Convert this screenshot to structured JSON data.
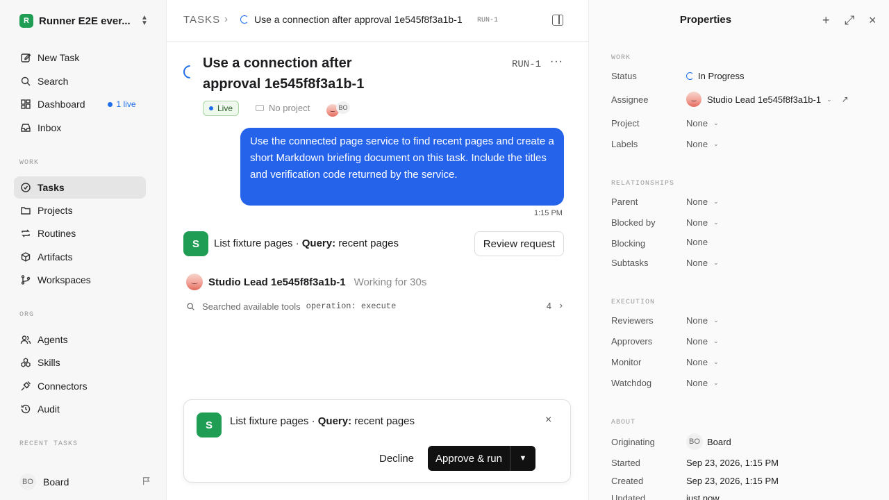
{
  "workspace": {
    "logo_letter": "R",
    "name": "Runner E2E ever..."
  },
  "sidebar": {
    "primary": [
      {
        "label": "New Task",
        "icon": "edit-icon"
      },
      {
        "label": "Search",
        "icon": "search-icon"
      },
      {
        "label": "Dashboard",
        "icon": "dashboard-icon",
        "live_count": "1 live"
      },
      {
        "label": "Inbox",
        "icon": "inbox-icon"
      }
    ],
    "work_label": "WORK",
    "work": [
      {
        "label": "Tasks",
        "icon": "check-circle-icon",
        "active": true
      },
      {
        "label": "Projects",
        "icon": "folder-icon"
      },
      {
        "label": "Routines",
        "icon": "repeat-icon"
      },
      {
        "label": "Artifacts",
        "icon": "box-icon"
      },
      {
        "label": "Workspaces",
        "icon": "branch-icon"
      }
    ],
    "org_label": "ORG",
    "org": [
      {
        "label": "Agents",
        "icon": "users-icon"
      },
      {
        "label": "Skills",
        "icon": "skills-icon"
      },
      {
        "label": "Connectors",
        "icon": "plug-icon"
      },
      {
        "label": "Audit",
        "icon": "history-icon"
      }
    ],
    "recent_label": "RECENT TASKS",
    "user": {
      "initials": "BO",
      "name": "Board"
    }
  },
  "header": {
    "crumb_root": "TASKS",
    "crumb_sep": "›",
    "task_title": "Use a connection after approval 1e545f8f3a1b-1",
    "task_id": "RUN-1"
  },
  "task": {
    "title": "Use a connection after approval 1e545f8f3a1b-1",
    "id": "RUN-1",
    "more": "···",
    "status_badge": "Live",
    "project": "No project",
    "assignee_initials": "BO"
  },
  "message": {
    "text": "Use the connected page service to find recent pages and create a short Markdown briefing document on this task. Include the titles and verification code returned by the service.",
    "time": "1:15 PM"
  },
  "request": {
    "badge": "S",
    "name": "List fixture pages",
    "sep": " · ",
    "query_label": "Query:",
    "query_value": " recent pages",
    "review_label": "Review request"
  },
  "agent": {
    "name": "Studio Lead 1e545f8f3a1b-1",
    "status": "Working for 30s"
  },
  "tool": {
    "text": "Searched available tools",
    "op": "operation: execute",
    "count": "4",
    "chevron": "›"
  },
  "approval": {
    "badge": "S",
    "name": "List fixture pages",
    "sep": " · ",
    "query_label": "Query:",
    "query_value": " recent pages",
    "close": "×",
    "decline": "Decline",
    "approve": "Approve & run",
    "dropdown": "▼"
  },
  "properties": {
    "title": "Properties",
    "add_icon": "+",
    "expand_icon": "⤢",
    "close_icon": "×",
    "work_label": "WORK",
    "status_label": "Status",
    "status_value": "In Progress",
    "assignee_label": "Assignee",
    "assignee_value": "Studio Lead 1e545f8f3a1b-1",
    "project_label": "Project",
    "project_value": "None",
    "labels_label": "Labels",
    "labels_value": "None",
    "relationships_label": "RELATIONSHIPS",
    "parent_label": "Parent",
    "parent_value": "None",
    "blocked_label": "Blocked by",
    "blocked_value": "None",
    "blocking_label": "Blocking",
    "blocking_value": "None",
    "subtasks_label": "Subtasks",
    "subtasks_value": "None",
    "execution_label": "EXECUTION",
    "reviewers_label": "Reviewers",
    "reviewers_value": "None",
    "approvers_label": "Approvers",
    "approvers_value": "None",
    "monitor_label": "Monitor",
    "monitor_value": "None",
    "watchdog_label": "Watchdog",
    "watchdog_value": "None",
    "about_label": "ABOUT",
    "originating_label": "Originating",
    "originating_initials": "BO",
    "originating_value": "Board",
    "started_label": "Started",
    "started_value": "Sep 23, 2026, 1:15 PM",
    "created_label": "Created",
    "created_value": "Sep 23, 2026, 1:15 PM",
    "updated_label": "Updated",
    "updated_value": "just now",
    "chev": "⌄",
    "ext": "↗"
  }
}
